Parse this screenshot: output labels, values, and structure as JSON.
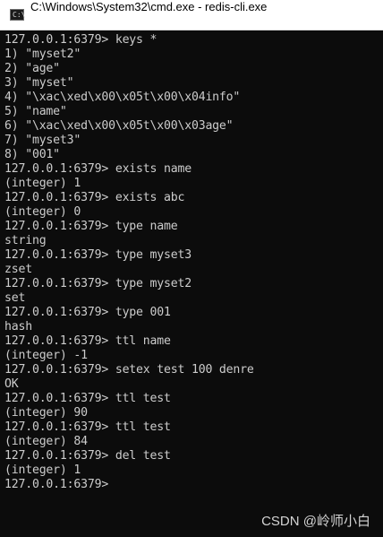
{
  "window": {
    "title": "C:\\Windows\\System32\\cmd.exe - redis-cli.exe",
    "icon": "cmd-icon",
    "icon_glyph": "C:\\"
  },
  "console": {
    "lines": [
      "127.0.0.1:6379> keys *",
      "1) \"myset2\"",
      "2) \"age\"",
      "3) \"myset\"",
      "4) \"\\xac\\xed\\x00\\x05t\\x00\\x04info\"",
      "5) \"name\"",
      "6) \"\\xac\\xed\\x00\\x05t\\x00\\x03age\"",
      "7) \"myset3\"",
      "8) \"001\"",
      "127.0.0.1:6379> exists name",
      "(integer) 1",
      "127.0.0.1:6379> exists abc",
      "(integer) 0",
      "127.0.0.1:6379> type name",
      "string",
      "127.0.0.1:6379> type myset3",
      "zset",
      "127.0.0.1:6379> type myset2",
      "set",
      "127.0.0.1:6379> type 001",
      "hash",
      "127.0.0.1:6379> ttl name",
      "(integer) -1",
      "127.0.0.1:6379> setex test 100 denre",
      "OK",
      "127.0.0.1:6379> ttl test",
      "(integer) 90",
      "127.0.0.1:6379> ttl test",
      "(integer) 84",
      "127.0.0.1:6379> del test",
      "(integer) 1",
      "127.0.0.1:6379>"
    ]
  },
  "watermark": "CSDN @岭师小白",
  "colors": {
    "background": "#0c0c0c",
    "text": "#cccccc",
    "titlebar": "#ffffff"
  }
}
